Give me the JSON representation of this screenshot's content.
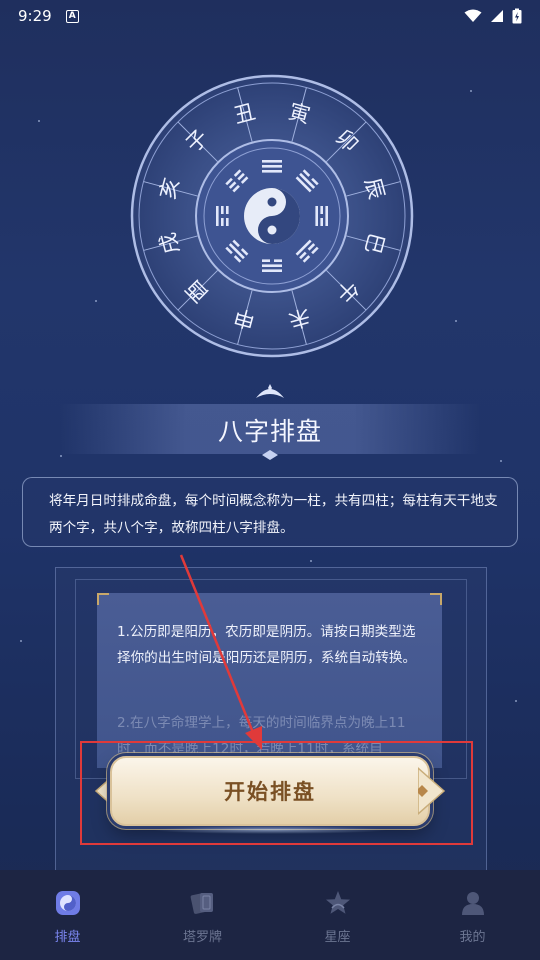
{
  "status_bar": {
    "time": "9:29",
    "notification_icon": "A"
  },
  "wheel": {
    "branches": [
      "子",
      "丑",
      "寅",
      "卯",
      "辰",
      "巳",
      "午",
      "未",
      "申",
      "酉",
      "戌",
      "亥"
    ],
    "center_icon": "yin-yang-icon"
  },
  "title": "八字排盘",
  "description": "将年月日时排成命盘，每个时间概念称为一柱，共有四柱；每柱有天干地支两个字，共八个字，故称四柱八字排盘。",
  "info": {
    "para1": "1.公历即是阳历，农历即是阴历。请按日期类型选择你的出生时间是阳历还是阴历，系统自动转换。",
    "para2": "2.在八字命理学上，每天的时间临界点为晚上11时，而不是晚上12时，若晚上11时，系统自"
  },
  "start_button": {
    "label": "开始排盘"
  },
  "nav": {
    "items": [
      {
        "label": "排盘",
        "icon": "yin-yang-icon",
        "active": true
      },
      {
        "label": "塔罗牌",
        "icon": "cards-icon",
        "active": false
      },
      {
        "label": "星座",
        "icon": "star-icon",
        "active": false
      },
      {
        "label": "我的",
        "icon": "person-icon",
        "active": false
      }
    ]
  },
  "colors": {
    "accent": "#7b86f0",
    "highlight": "#e03a3a",
    "button_text": "#7a5024"
  }
}
